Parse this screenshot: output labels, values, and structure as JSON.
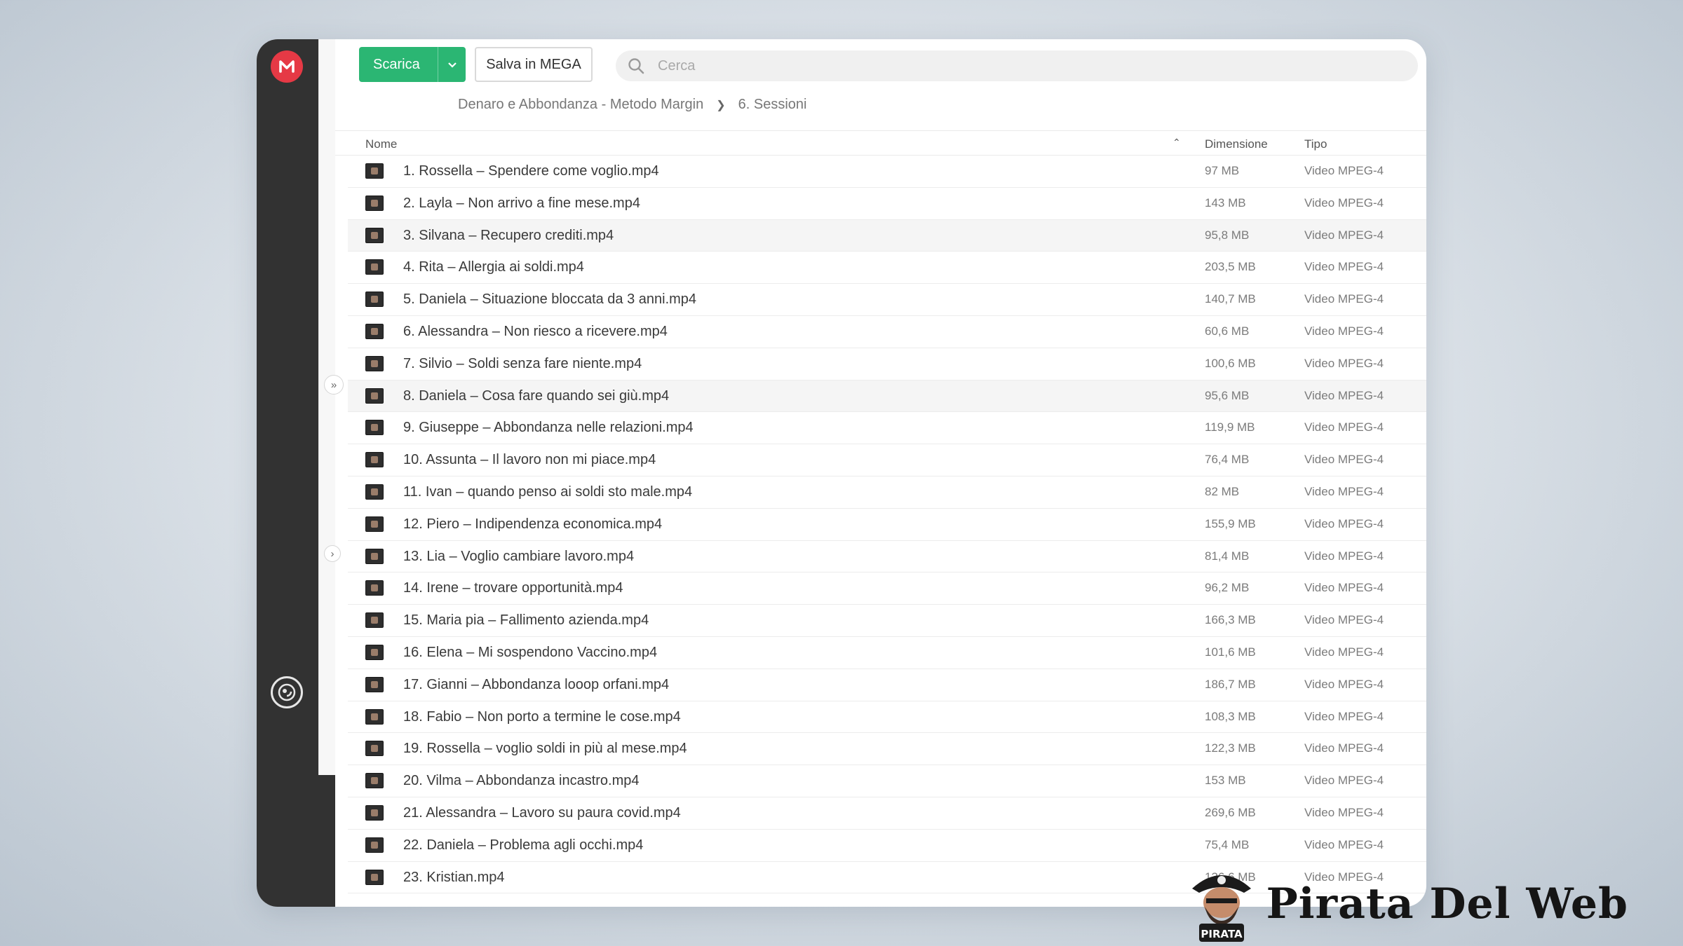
{
  "sidebar": {
    "logo_letter": "M",
    "icons": [
      "mega-logo-icon",
      "user-avatar-icon"
    ]
  },
  "toolbar": {
    "download_label": "Scarica",
    "save_label": "Salva in MEGA"
  },
  "search": {
    "placeholder": "Cerca",
    "value": ""
  },
  "breadcrumb": {
    "parent": "Denaro e Abbondanza - Metodo Margin",
    "current": "6. Sessioni"
  },
  "table": {
    "col_name": "Nome",
    "col_size": "Dimensione",
    "col_type": "Tipo",
    "files": [
      {
        "name": "1. Rossella – Spendere come voglio.mp4",
        "size": "97 MB",
        "type": "Video MPEG-4"
      },
      {
        "name": "2. Layla – Non arrivo a fine mese.mp4",
        "size": "143 MB",
        "type": "Video MPEG-4"
      },
      {
        "name": "3. Silvana – Recupero crediti.mp4",
        "size": "95,8 MB",
        "type": "Video MPEG-4"
      },
      {
        "name": "4. Rita – Allergia ai soldi.mp4",
        "size": "203,5 MB",
        "type": "Video MPEG-4"
      },
      {
        "name": "5. Daniela – Situazione bloccata da 3 anni.mp4",
        "size": "140,7 MB",
        "type": "Video MPEG-4"
      },
      {
        "name": "6. Alessandra – Non riesco a ricevere.mp4",
        "size": "60,6 MB",
        "type": "Video MPEG-4"
      },
      {
        "name": "7. Silvio – Soldi senza fare niente.mp4",
        "size": "100,6 MB",
        "type": "Video MPEG-4"
      },
      {
        "name": "8. Daniela – Cosa fare quando sei giù.mp4",
        "size": "95,6 MB",
        "type": "Video MPEG-4"
      },
      {
        "name": "9. Giuseppe – Abbondanza nelle relazioni.mp4",
        "size": "119,9 MB",
        "type": "Video MPEG-4"
      },
      {
        "name": "10. Assunta – Il lavoro non mi piace.mp4",
        "size": "76,4 MB",
        "type": "Video MPEG-4"
      },
      {
        "name": "11. Ivan – quando penso ai soldi sto male.mp4",
        "size": "82 MB",
        "type": "Video MPEG-4"
      },
      {
        "name": "12. Piero – Indipendenza economica.mp4",
        "size": "155,9 MB",
        "type": "Video MPEG-4"
      },
      {
        "name": "13. Lia – Voglio cambiare lavoro.mp4",
        "size": "81,4 MB",
        "type": "Video MPEG-4"
      },
      {
        "name": "14. Irene – trovare opportunità.mp4",
        "size": "96,2 MB",
        "type": "Video MPEG-4"
      },
      {
        "name": "15. Maria pia – Fallimento azienda.mp4",
        "size": "166,3 MB",
        "type": "Video MPEG-4"
      },
      {
        "name": "16. Elena – Mi sospendono Vaccino.mp4",
        "size": "101,6 MB",
        "type": "Video MPEG-4"
      },
      {
        "name": "17. Gianni – Abbondanza looop orfani.mp4",
        "size": "186,7 MB",
        "type": "Video MPEG-4"
      },
      {
        "name": "18. Fabio – Non porto a termine le cose.mp4",
        "size": "108,3 MB",
        "type": "Video MPEG-4"
      },
      {
        "name": "19. Rossella – voglio soldi in più al mese.mp4",
        "size": "122,3 MB",
        "type": "Video MPEG-4"
      },
      {
        "name": "20. Vilma – Abbondanza incastro.mp4",
        "size": "153 MB",
        "type": "Video MPEG-4"
      },
      {
        "name": "21. Alessandra – Lavoro su paura covid.mp4",
        "size": "269,6 MB",
        "type": "Video MPEG-4"
      },
      {
        "name": "22. Daniela – Problema agli occhi.mp4",
        "size": "75,4 MB",
        "type": "Video MPEG-4"
      },
      {
        "name": "23. Kristian.mp4",
        "size": "136,6 MB",
        "type": "Video MPEG-4"
      }
    ]
  },
  "watermark": {
    "text": "Pirata Del Web",
    "badge": "PIRATA"
  }
}
